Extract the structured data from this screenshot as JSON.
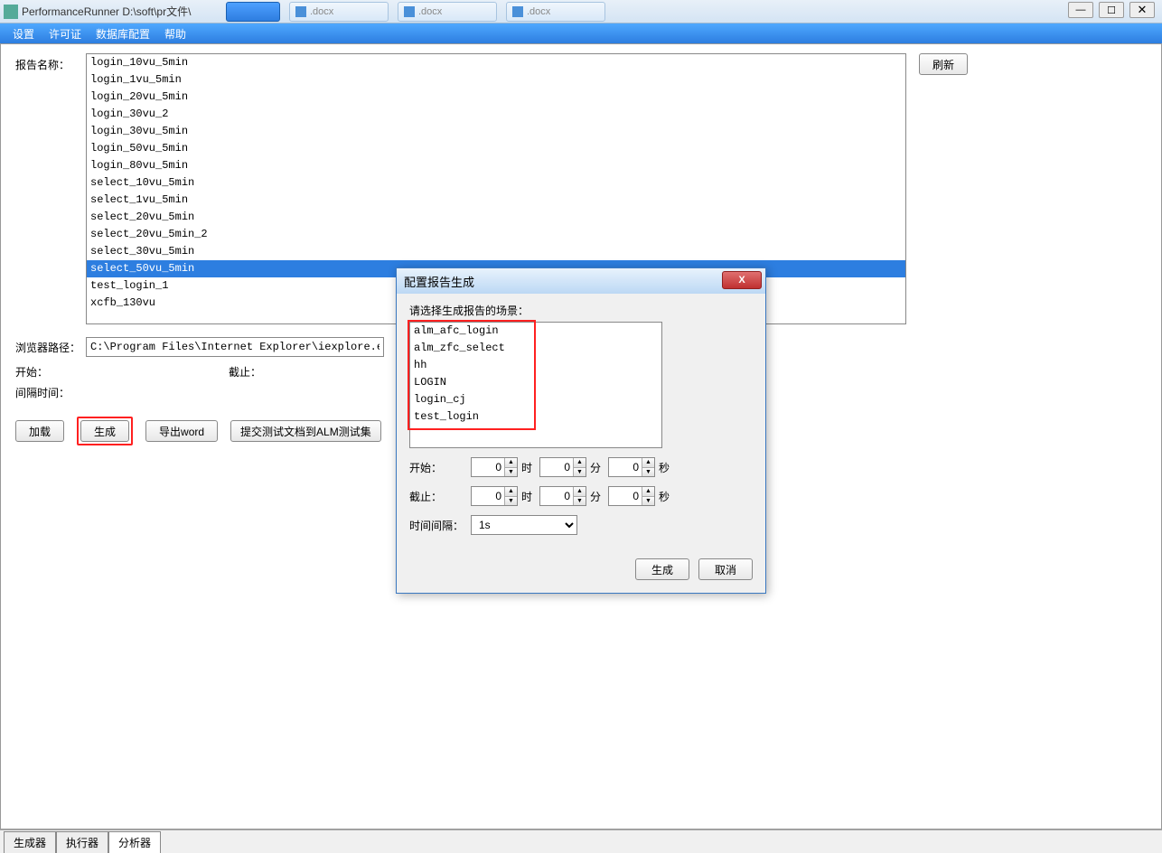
{
  "window": {
    "title": "PerformanceRunner  D:\\soft\\pr文件\\",
    "controls": {
      "min": "—",
      "max": "☐",
      "close": "✕"
    }
  },
  "taskbar": [
    {
      "label": "",
      "active": true
    },
    {
      "label": ".docx"
    },
    {
      "label": ".docx"
    },
    {
      "label": ".docx"
    }
  ],
  "menu": {
    "settings": "设置",
    "license": "许可证",
    "db_config": "数据库配置",
    "help": "帮助"
  },
  "labels": {
    "report_name": "报告名称：",
    "browser_path": "浏览器路径：",
    "start": "开始：",
    "end": "截止：",
    "interval": "间隔时间："
  },
  "report_list": [
    "login_10vu_5min",
    "login_1vu_5min",
    "login_20vu_5min",
    "login_30vu_2",
    "login_30vu_5min",
    "login_50vu_5min",
    "login_80vu_5min",
    "select_10vu_5min",
    "select_1vu_5min",
    "select_20vu_5min",
    "select_20vu_5min_2",
    "select_30vu_5min",
    "select_50vu_5min",
    "test_login_1",
    "xcfb_130vu"
  ],
  "report_selected_index": 12,
  "browser_path_value": "C:\\Program Files\\Internet Explorer\\iexplore.exe",
  "buttons": {
    "refresh": "刷新",
    "load": "加载",
    "generate": "生成",
    "export_word": "导出word",
    "submit_alm": "提交测试文档到ALM测试集"
  },
  "bottom_tabs": {
    "generator": "生成器",
    "executor": "执行器",
    "analyzer": "分析器"
  },
  "dialog": {
    "title": "配置报告生成",
    "scene_prompt": "请选择生成报告的场景：",
    "scenes": [
      "alm_afc_login",
      "alm_zfc_select",
      "hh",
      "LOGIN",
      "login_cj",
      "test_login"
    ],
    "labels": {
      "start": "开始：",
      "end": "截止：",
      "interval": "时间间隔：",
      "hour": "时",
      "minute": "分",
      "second": "秒"
    },
    "time_values": {
      "start_h": "0",
      "start_m": "0",
      "start_s": "0",
      "end_h": "0",
      "end_m": "0",
      "end_s": "0"
    },
    "interval_value": "1s",
    "buttons": {
      "generate": "生成",
      "cancel": "取消"
    }
  }
}
